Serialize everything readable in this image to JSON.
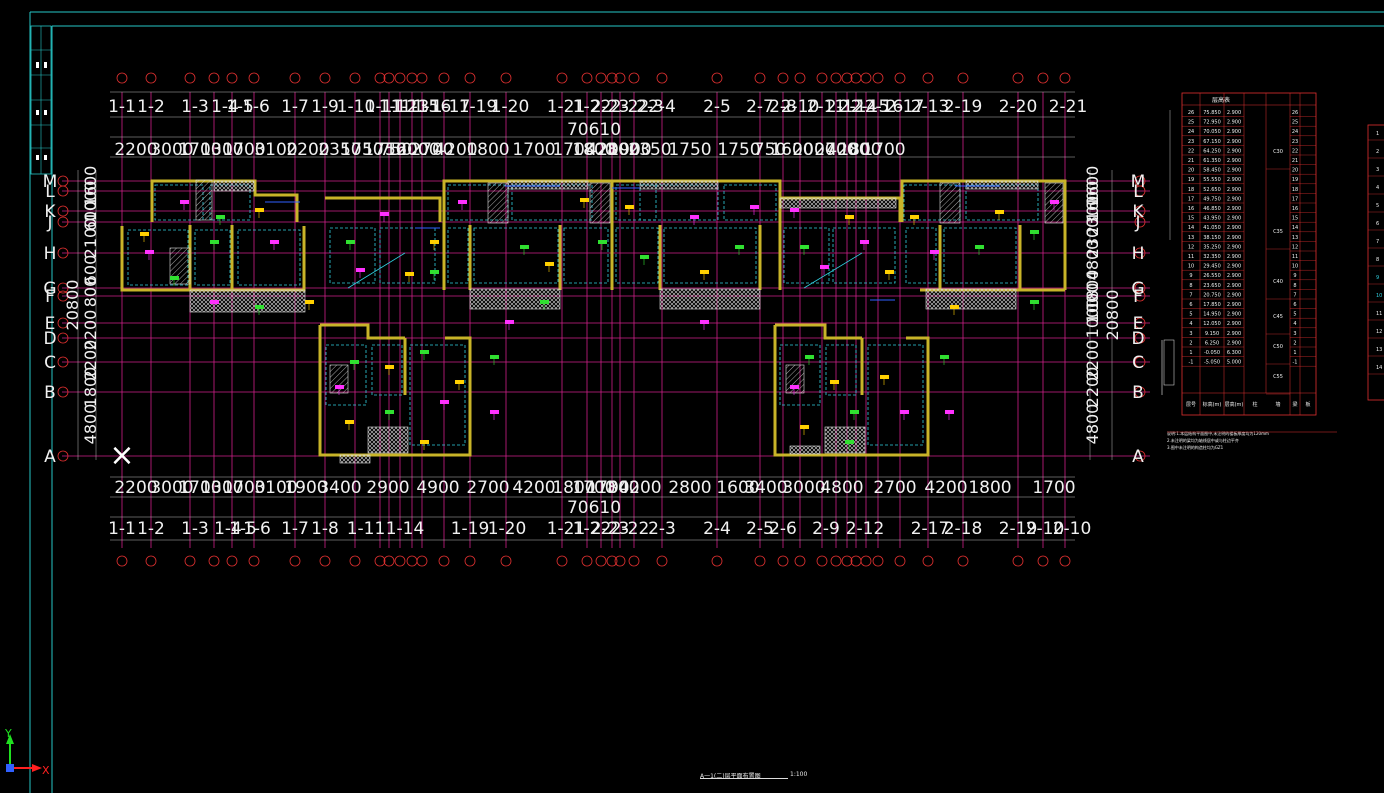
{
  "app": {
    "colors": {
      "background": "#000000",
      "border_cyan": "#26c6c6",
      "grid_magenta": "#d0208a",
      "grid_red": "#e03030",
      "dim_white": "#f0f0f0",
      "wall_yellow": "#c8b428",
      "hatch_white": "#cfcfcf",
      "cyan_line": "#30d0e0",
      "green_text": "#30e030",
      "magenta_text": "#ff30ff",
      "yellow_text": "#ffd000",
      "blue_line": "#3060ff",
      "axis_y_green": "#20e020",
      "axis_x_red": "#ff2020"
    },
    "ucs": {
      "x_label": "X",
      "y_label": "Y",
      "icon": "ucs-axis-icon"
    }
  },
  "drawing": {
    "title": "A一1(二)层平面布置图",
    "scale": "1:100",
    "total_dimension_top": "70610",
    "total_dimension_bottom": "70610",
    "top_axis_labels": [
      "1-1",
      "1-2",
      "1-3",
      "1-4",
      "1-5",
      "1-6",
      "1-7",
      "1-9",
      "1-10",
      "1-11",
      "1-12",
      "1-13",
      "1-15",
      "1-16",
      "1-17",
      "1-19",
      "1-20",
      "1-21",
      "1-22",
      "2-23",
      "2-22",
      "2-3",
      "2-4",
      "2-5",
      "2-7",
      "2-8",
      "2-10",
      "2-11",
      "2-12",
      "2-14",
      "2-15",
      "2-16",
      "2-17",
      "2-13",
      "2-19",
      "2-20",
      "2-21"
    ],
    "bottom_axis_labels": [
      "1-1",
      "1-2",
      "1-3",
      "1-4",
      "1-5",
      "1-6",
      "1-7",
      "1-8",
      "1-11",
      "1-14",
      "1-19",
      "1-20",
      "1-21",
      "1-22",
      "2-23",
      "2-22",
      "2-3",
      "2-4",
      "2-5",
      "2-6",
      "2-9",
      "2-12",
      "2-17",
      "2-18",
      "2-19",
      "2-10",
      "2-10"
    ],
    "top_dimensions": [
      "2200",
      "3000",
      "1700",
      "1300",
      "1700",
      "3100",
      "2200",
      "2350",
      "1750",
      "1750",
      "750",
      "1600",
      "2000",
      "2700",
      "4200",
      "1800",
      "1700",
      "1700",
      "1800",
      "4200",
      "2800",
      "1900",
      "2350",
      "1750",
      "1750",
      "750",
      "1600",
      "2000",
      "2700",
      "4200",
      "1800",
      "1700"
    ],
    "bottom_dimensions": [
      "2200",
      "3000",
      "1700",
      "1300",
      "1700",
      "3100",
      "1900",
      "3400",
      "2900",
      "4900",
      "2700",
      "4200",
      "1800",
      "1700",
      "1700",
      "1800",
      "4200",
      "2800",
      "1600",
      "3400",
      "3000",
      "4800",
      "2700",
      "4200",
      "1800",
      "1700"
    ],
    "row_labels_left": [
      "M",
      "L",
      "K",
      "J",
      "H",
      "G",
      "F",
      "E",
      "D",
      "C",
      "B",
      "A"
    ],
    "row_labels_right": [
      "M",
      "L",
      "K",
      "J",
      "H",
      "G",
      "F",
      "E",
      "D",
      "C",
      "B",
      "A"
    ],
    "left_dimensions": [
      "1600",
      "1000",
      "600",
      "2100",
      "600",
      "800",
      "20800",
      "2200",
      "2200",
      "1800",
      "4800"
    ],
    "right_dimensions": [
      "1600",
      "1600",
      "2300",
      "2300",
      "4800",
      "1800",
      "1000",
      "1000",
      "20800",
      "2200",
      "2200",
      "4800"
    ],
    "reference_marker": "×"
  },
  "schedule_table": {
    "title": "层高表",
    "rows": [
      [
        "26",
        "75.850",
        "2.900"
      ],
      [
        "25",
        "72.950",
        "2.900"
      ],
      [
        "24",
        "70.050",
        "2.900"
      ],
      [
        "23",
        "67.150",
        "2.900"
      ],
      [
        "22",
        "64.250",
        "2.900"
      ],
      [
        "21",
        "61.350",
        "2.900"
      ],
      [
        "20",
        "58.450",
        "2.900"
      ],
      [
        "19",
        "55.550",
        "2.900"
      ],
      [
        "18",
        "52.650",
        "2.900"
      ],
      [
        "17",
        "49.750",
        "2.900"
      ],
      [
        "16",
        "46.850",
        "2.900"
      ],
      [
        "15",
        "43.950",
        "2.900"
      ],
      [
        "14",
        "41.050",
        "2.900"
      ],
      [
        "13",
        "38.150",
        "2.900"
      ],
      [
        "12",
        "35.250",
        "2.900"
      ],
      [
        "11",
        "32.350",
        "2.900"
      ],
      [
        "10",
        "29.450",
        "2.900"
      ],
      [
        "9",
        "26.550",
        "2.900"
      ],
      [
        "8",
        "23.650",
        "2.900"
      ],
      [
        "7",
        "20.750",
        "2.900"
      ],
      [
        "6",
        "17.850",
        "2.900"
      ],
      [
        "5",
        "14.950",
        "2.900"
      ],
      [
        "4",
        "12.050",
        "2.900"
      ],
      [
        "3",
        "9.150",
        "2.900"
      ],
      [
        "2",
        "6.250",
        "2.900"
      ],
      [
        "1",
        "-0.050",
        "6.300"
      ],
      [
        "-1",
        "-5.050",
        "5.000"
      ]
    ],
    "grade_labels": [
      "C30",
      "C35",
      "C40",
      "C45",
      "C50",
      "C55"
    ],
    "footer_headers": [
      "层号",
      "标高(m)",
      "层高(m)",
      "柱",
      "墙",
      "梁",
      "板"
    ],
    "notes": [
      "说明:1.本层结构平面图中,未注明的楼板厚度均为120mm",
      "2.未注明的梁均为轴线居中或与柱边平齐",
      "3.图中未注明的构造柱均为GZ1"
    ]
  }
}
